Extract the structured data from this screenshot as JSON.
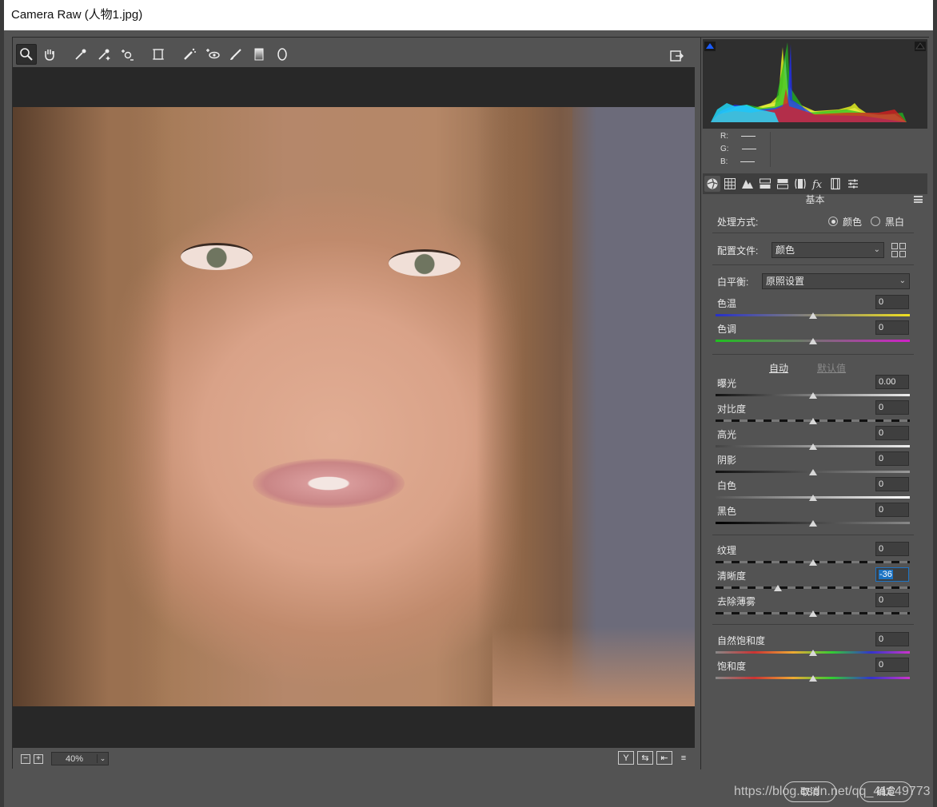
{
  "window": {
    "title": "Camera Raw (人物1.jpg)"
  },
  "toolbar": {
    "tools": [
      "zoom-icon",
      "hand-icon",
      "white-balance-icon",
      "color-sampler-icon",
      "targeted-adjustment-icon",
      "transform-icon",
      "spot-removal-icon",
      "red-eye-icon",
      "adjustment-brush-icon",
      "graduated-filter-icon",
      "radial-filter-icon"
    ],
    "export_icon": "open-export-icon"
  },
  "bottombar": {
    "zoom_out": "−",
    "zoom_in": "+",
    "zoom_value": "40%",
    "zoom_arrow": "⌄",
    "view_y": "Y",
    "view_swap": "⇆",
    "view_copy": "⇤",
    "view_prefs": "≡"
  },
  "histogram": {
    "r_label": "R:",
    "g_label": "G:",
    "b_label": "B:"
  },
  "panel": {
    "section_title": "基本",
    "treatment_label": "处理方式:",
    "treatment_color": "颜色",
    "treatment_bw": "黑白",
    "treatment_selected": "颜色",
    "profile_label": "配置文件:",
    "profile_value": "颜色",
    "wb_label": "白平衡:",
    "wb_value": "原照设置",
    "auto_label": "自动",
    "default_label": "默认值",
    "sliders": [
      {
        "name": "色温",
        "value": "0",
        "pos": 0.5
      },
      {
        "name": "色调",
        "value": "0",
        "pos": 0.5
      },
      {
        "name": "曝光",
        "value": "0.00",
        "pos": 0.5
      },
      {
        "name": "对比度",
        "value": "0",
        "pos": 0.5
      },
      {
        "name": "高光",
        "value": "0",
        "pos": 0.5
      },
      {
        "name": "阴影",
        "value": "0",
        "pos": 0.5
      },
      {
        "name": "白色",
        "value": "0",
        "pos": 0.5
      },
      {
        "name": "黑色",
        "value": "0",
        "pos": 0.5
      },
      {
        "name": "纹理",
        "value": "0",
        "pos": 0.5
      },
      {
        "name": "清晰度",
        "value": "-36",
        "pos": 0.32
      },
      {
        "name": "去除薄雾",
        "value": "0",
        "pos": 0.5
      },
      {
        "name": "自然饱和度",
        "value": "0",
        "pos": 0.5
      },
      {
        "name": "饱和度",
        "value": "0",
        "pos": 0.5
      }
    ]
  },
  "footer": {
    "cancel": "取消",
    "ok": "确定",
    "watermark": "https://blog.csdn.net/qq_41649773"
  },
  "colors": {
    "panel_bg": "#535353",
    "selection_blue": "#1d74c4"
  }
}
